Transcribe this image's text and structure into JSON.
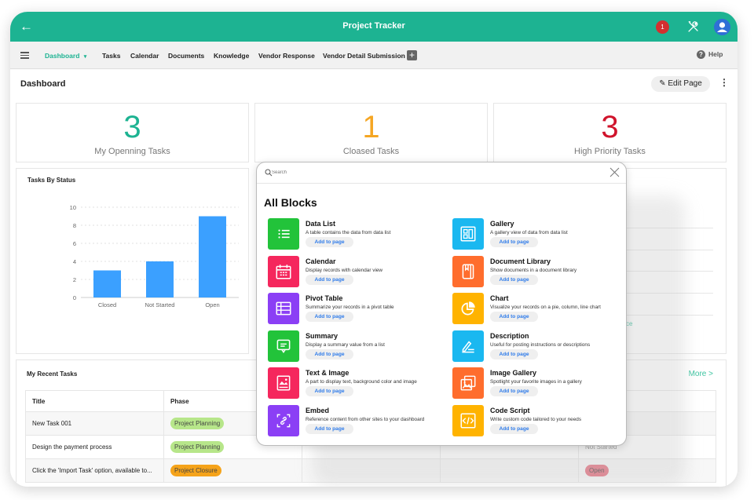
{
  "app": {
    "title": "Project Tracker",
    "notification_count": "1",
    "accent": "#1db392"
  },
  "nav": {
    "items": [
      {
        "label": "Dashboard",
        "active": true
      },
      {
        "label": "Tasks"
      },
      {
        "label": "Calendar"
      },
      {
        "label": "Documents"
      },
      {
        "label": "Knowledge"
      },
      {
        "label": "Vendor Response"
      },
      {
        "label": "Vendor Detail Submission"
      }
    ],
    "dropdown_glyph": "▾",
    "add_glyph": "+",
    "help_label": "Help",
    "help_glyph": "?"
  },
  "page": {
    "title": "Dashboard",
    "edit_label": "Edit Page",
    "more_glyph": "⋮"
  },
  "stats": [
    {
      "value": "3",
      "label": "My Openning Tasks",
      "color": "#1db392"
    },
    {
      "value": "1",
      "label": "Cloased Tasks",
      "color": "#f5a623"
    },
    {
      "value": "3",
      "label": "High Priority Tasks",
      "color": "#d0142c"
    }
  ],
  "chart_card": {
    "title": "Tasks By Status"
  },
  "chart_data": {
    "type": "bar",
    "title": "Tasks By Status",
    "categories": [
      "Closed",
      "Not Started",
      "Open"
    ],
    "values": [
      3,
      4,
      9
    ],
    "yticks": [
      "0",
      "2",
      "4",
      "6",
      "8",
      "10"
    ],
    "ylim": [
      0,
      10
    ],
    "xlabel": "",
    "ylabel": "",
    "grid": true,
    "bar_color": "#3ba0ff"
  },
  "recent": {
    "title": "My Recent Tasks",
    "more_label": "More",
    "more_glyph": ">",
    "columns": [
      "Title",
      "Phase"
    ],
    "rows": [
      {
        "title": "New Task 001",
        "phase": "Project Planning",
        "phase_color": "#b7e68a"
      },
      {
        "title": "Design the payment process",
        "phase": "Project Planning",
        "phase_color": "#b7e68a"
      },
      {
        "title": "Click the 'Import Task' option, available to...",
        "phase": "Project Closure",
        "phase_color": "#f5a31a"
      }
    ],
    "status_partial": [
      "Not Started",
      "Open"
    ],
    "status_open_color": "#e57080"
  },
  "side_partial_text": "ce",
  "modal": {
    "search_placeholder": "Search",
    "heading": "All Blocks",
    "add_label": "Add to page",
    "blocks": [
      {
        "name": "Data List",
        "desc": "A table contains the data from data list",
        "icon": "list-icon",
        "color": "#22c33a"
      },
      {
        "name": "Gallery",
        "desc": "A gallery view of data from data list",
        "icon": "gallery-icon",
        "color": "#1ab8f0"
      },
      {
        "name": "Calendar",
        "desc": "Display records with calendar view",
        "icon": "calendar-icon",
        "color": "#f5275d"
      },
      {
        "name": "Document Library",
        "desc": "Show documents in a document library",
        "icon": "book-icon",
        "color": "#ff6d2d"
      },
      {
        "name": "Pivot Table",
        "desc": "Summarize your records in a pivot table",
        "icon": "table-icon",
        "color": "#8b3ff5"
      },
      {
        "name": "Chart",
        "desc": "Visualize your records on a pie, column, line chart",
        "icon": "pie-chart-icon",
        "color": "#ffb300"
      },
      {
        "name": "Summary",
        "desc": "Display a summary value from a list",
        "icon": "comment-icon",
        "color": "#22c33a"
      },
      {
        "name": "Description",
        "desc": "Useful for posting instructions or descriptions",
        "icon": "pen-icon",
        "color": "#1ab8f0"
      },
      {
        "name": "Text & Image",
        "desc": "A part to display text, background color and image",
        "icon": "image-card-icon",
        "color": "#f5275d"
      },
      {
        "name": "Image Gallery",
        "desc": "Spotlight your favorite images in a gallery",
        "icon": "images-icon",
        "color": "#ff6d2d"
      },
      {
        "name": "Embed",
        "desc": "Reference content from other sites to your dashboard",
        "icon": "link-icon",
        "color": "#8b3ff5"
      },
      {
        "name": "Code Script",
        "desc": "Write custom code tailored to your needs",
        "icon": "code-icon",
        "color": "#ffb300"
      }
    ]
  }
}
